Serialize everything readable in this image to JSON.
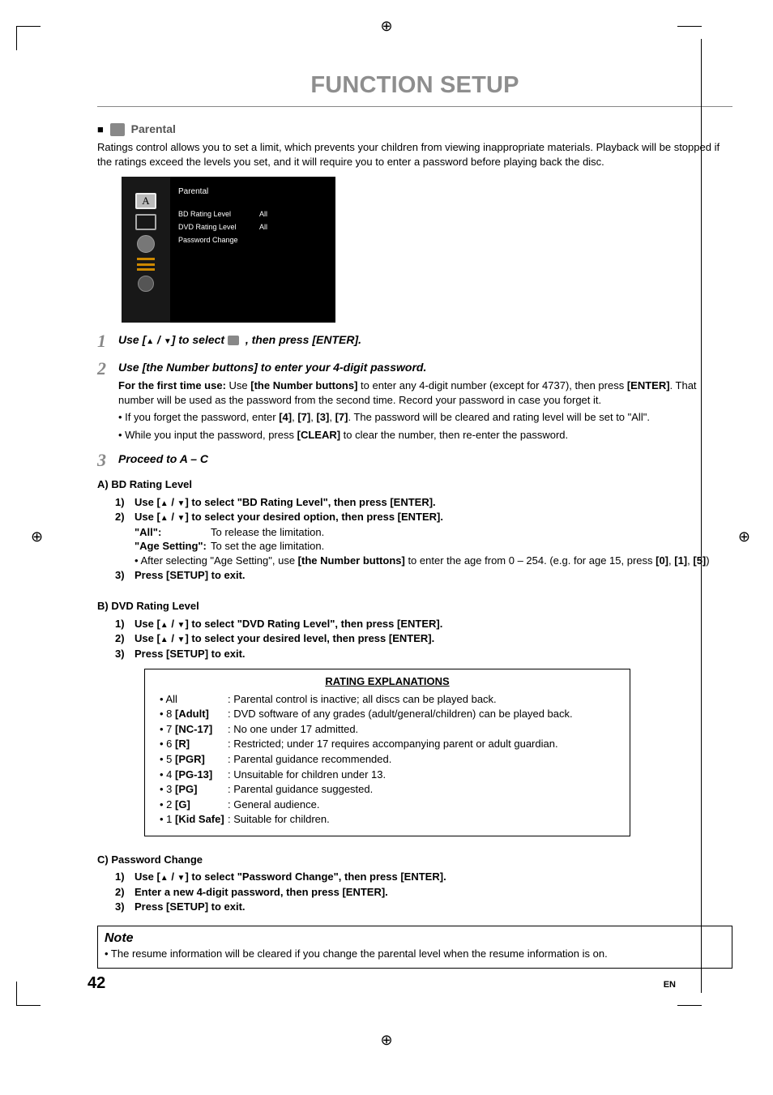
{
  "title": "FUNCTION SETUP",
  "section": {
    "icon_name": "parental-icon",
    "heading": "Parental"
  },
  "intro": "Ratings control allows you to set a limit, which prevents your children from viewing inappropriate materials. Playback will be stopped if the ratings exceed the levels you set, and it will require you to enter a password before playing back the disc.",
  "osd": {
    "heading": "Parental",
    "rows": [
      {
        "label": "BD Rating Level",
        "value": "All"
      },
      {
        "label": "DVD Rating Level",
        "value": "All"
      },
      {
        "label": "Password Change",
        "value": ""
      }
    ]
  },
  "steps": {
    "s1": {
      "num": "1",
      "title_pre": "Use [",
      "title_mid": " / ",
      "title_post": "] to select ",
      "title_tail": " , then press [ENTER]."
    },
    "s2": {
      "num": "2",
      "title": "Use [the Number buttons] to enter your 4-digit password.",
      "lines": [
        "For the first time use: Use [the Number buttons] to enter any 4-digit number (except for 4737), then press [ENTER]. That number will be used as the password from the second time. Record your password in case you forget it.",
        "• If you forget the password, enter [4], [7], [3], [7]. The password will be cleared and rating level will be set to \"All\".",
        "• While you input the password, press [CLEAR] to clear the number, then re-enter the password."
      ],
      "first_bold": "For the first time use:",
      "l1_plain_a": " Use ",
      "l1_bold_a": "[the Number buttons]",
      "l1_plain_b": " to enter any 4-digit number (except for 4737), then press ",
      "l1_bold_b": "[ENTER]",
      "l1_plain_c": ". That number will be used as the password from the second time. Record your password in case you forget it.",
      "l2_a": "• If you forget the password, enter ",
      "l2_k1": "[4]",
      "l2_c": ", ",
      "l2_k2": "[7]",
      "l2_k3": "[3]",
      "l2_k4": "[7]",
      "l2_b": ". The password will be cleared and rating level will be set to \"All\".",
      "l3_a": "• While you input the password, press ",
      "l3_b": "[CLEAR]",
      "l3_c": " to clear the number, then re-enter the password."
    },
    "s3": {
      "num": "3",
      "title": "Proceed to A – C"
    }
  },
  "sectA": {
    "head": "A)  BD Rating Level",
    "i1_pre": "Use [",
    "i1_mid": " / ",
    "i1_post": "] to select \"BD Rating Level\", then press [ENTER].",
    "i2_pre": "Use [",
    "i2_mid": " / ",
    "i2_post": "] to select your desired option, then press [ENTER].",
    "opt1_l": "\"All\":",
    "opt1_t": "To release the limitation.",
    "opt2_l": "\"Age Setting\":",
    "opt2_t": "To set the age limitation.",
    "age_a": "• After selecting \"Age Setting\", use ",
    "age_b": "[the Number buttons]",
    "age_c": " to enter the age from 0 – 254. (e.g. for age 15, press ",
    "age_k1": "[0]",
    "age_c2": ", ",
    "age_k2": "[1]",
    "age_k3": "[5]",
    "age_d": ")",
    "i3": "Press [SETUP] to exit."
  },
  "sectB": {
    "head": "B)  DVD Rating Level",
    "i1_pre": "Use [",
    "i1_mid": " / ",
    "i1_post": "] to select \"DVD Rating Level\", then press [ENTER].",
    "i2_pre": "Use [",
    "i2_mid": " / ",
    "i2_post": "] to select your desired level, then press [ENTER].",
    "i3": "Press [SETUP] to exit."
  },
  "ratings": {
    "title": "RATING EXPLANATIONS",
    "rows": [
      {
        "name": "• All",
        "desc": ": Parental control is inactive; all discs can be played back."
      },
      {
        "name": "• 8 [Adult]",
        "desc": ": DVD software of any grades (adult/general/children) can be played back."
      },
      {
        "name": "• 7 [NC-17]",
        "desc": ": No one under 17 admitted."
      },
      {
        "name": "• 6 [R]",
        "desc": ": Restricted; under 17 requires accompanying parent or adult guardian."
      },
      {
        "name": "• 5 [PGR]",
        "desc": ": Parental guidance recommended."
      },
      {
        "name": "• 4 [PG-13]",
        "desc": ": Unsuitable for children under 13."
      },
      {
        "name": "• 3 [PG]",
        "desc": ": Parental guidance suggested."
      },
      {
        "name": "• 2 [G]",
        "desc": ": General audience."
      },
      {
        "name": "• 1 [Kid Safe]",
        "desc": ": Suitable for children."
      }
    ]
  },
  "sectC": {
    "head": "C)  Password Change",
    "i1_pre": "Use [",
    "i1_mid": " / ",
    "i1_post": "] to select \"Password Change\", then press [ENTER].",
    "i2": "Enter a new 4-digit password, then press [ENTER].",
    "i3": "Press [SETUP] to exit."
  },
  "note": {
    "head": "Note",
    "text": "• The resume information will be cleared if you change the parental level when the resume information is on."
  },
  "footer": {
    "page": "42",
    "lang": "EN"
  },
  "n": {
    "n1": "1)",
    "n2": "2)",
    "n3": "3)"
  },
  "tri": {
    "up": "▲",
    "down": "▼"
  },
  "sidebar_letter": "A"
}
